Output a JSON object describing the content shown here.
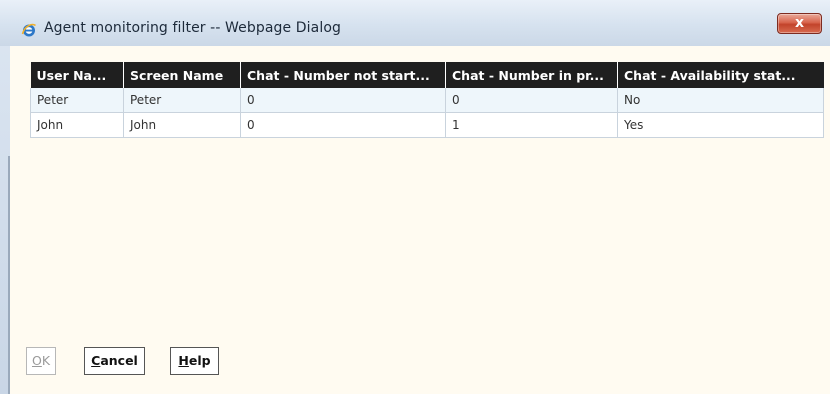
{
  "window": {
    "title": "Agent monitoring filter -- Webpage Dialog",
    "close_glyph": "x"
  },
  "table": {
    "columns": [
      "User Na...",
      "Screen Name",
      "Chat - Number not start...",
      "Chat - Number in pr...",
      "Chat - Availability stat..."
    ],
    "rows": [
      [
        "Peter",
        "Peter",
        "0",
        "0",
        "No"
      ],
      [
        "John",
        "John",
        "0",
        "1",
        "Yes"
      ]
    ]
  },
  "buttons": {
    "ok": {
      "accel": "O",
      "rest": "K"
    },
    "cancel": {
      "accel": "C",
      "rest": "ancel"
    },
    "help": {
      "accel": "H",
      "rest": "elp"
    }
  },
  "colors": {
    "header_bg": "#1f1f1f",
    "header_text": "#ffffff",
    "content_bg": "#fffbf1",
    "row_alt_bg": "#eef6fb",
    "close_red": "#c2432b"
  },
  "icons": {
    "app_icon": "internet-explorer-icon",
    "close_icon": "close-icon"
  }
}
